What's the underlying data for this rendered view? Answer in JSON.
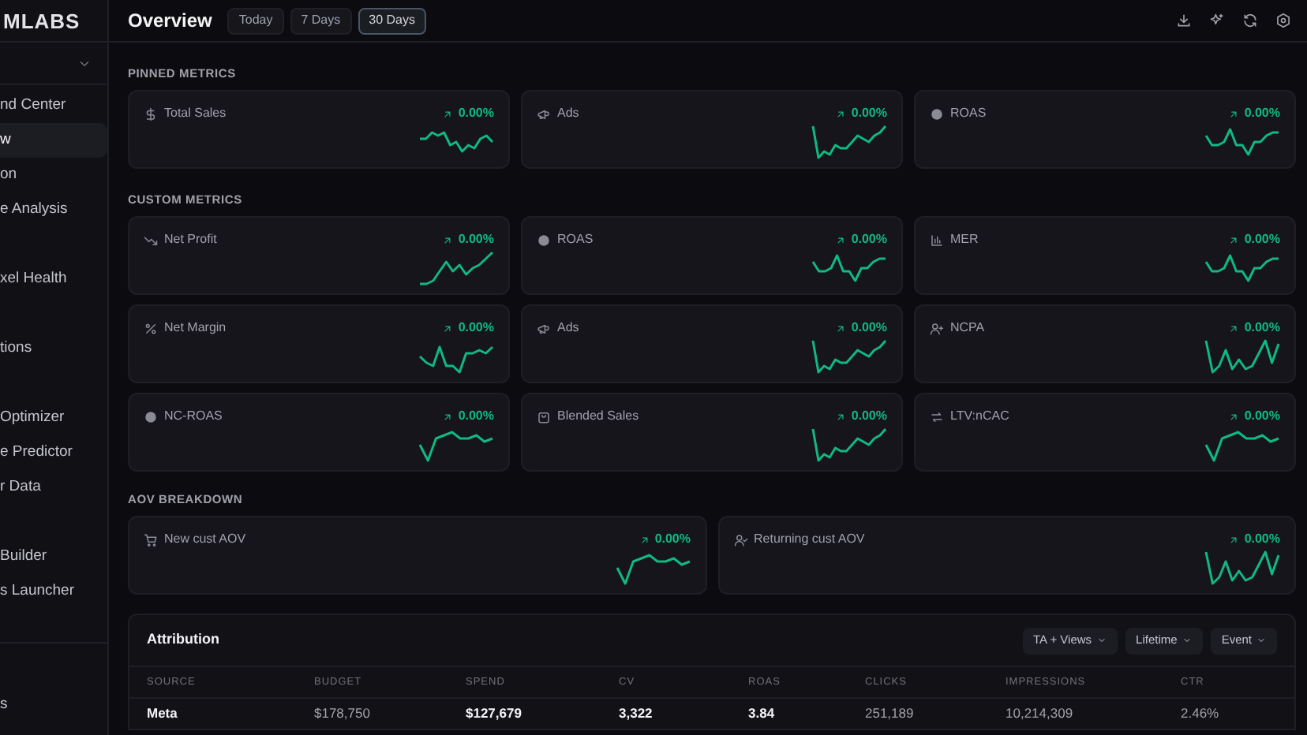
{
  "sidebar": {
    "logo": "MLABS",
    "groups": [
      {
        "items": [
          {
            "label": "nd Center",
            "selected": false
          },
          {
            "label": "w",
            "selected": true
          },
          {
            "label": "on",
            "selected": false
          },
          {
            "label": "e Analysis",
            "selected": false
          }
        ]
      },
      {
        "items": [
          {
            "label": "xel Health",
            "selected": false
          }
        ]
      },
      {
        "items": [
          {
            "label": "tions",
            "selected": false
          }
        ]
      },
      {
        "items": [
          {
            "label": "Optimizer",
            "selected": false
          },
          {
            "label": "e Predictor",
            "selected": false
          },
          {
            "label": "r Data",
            "selected": false
          }
        ]
      },
      {
        "items": [
          {
            "label": "Builder",
            "selected": false
          },
          {
            "label": "s Launcher",
            "selected": false
          }
        ]
      }
    ],
    "footer": "s"
  },
  "header": {
    "title": "Overview",
    "ranges": [
      {
        "label": "Today",
        "selected": false
      },
      {
        "label": "7 Days",
        "selected": false
      },
      {
        "label": "30 Days",
        "selected": true
      }
    ]
  },
  "sections": [
    {
      "title": "PINNED METRICS",
      "cards": [
        {
          "label": "Total Sales",
          "change": "0.00%"
        },
        {
          "label": "Ads",
          "change": "0.00%"
        },
        {
          "label": "ROAS",
          "change": "0.00%"
        }
      ]
    },
    {
      "title": "CUSTOM METRICS",
      "cards": [
        {
          "label": "Net Profit",
          "change": "0.00%"
        },
        {
          "label": "ROAS",
          "change": "0.00%"
        },
        {
          "label": "MER",
          "change": "0.00%"
        },
        {
          "label": "Net Margin",
          "change": "0.00%"
        },
        {
          "label": "Ads",
          "change": "0.00%"
        },
        {
          "label": "NCPA",
          "change": "0.00%"
        },
        {
          "label": "NC-ROAS",
          "change": "0.00%"
        },
        {
          "label": "Blended Sales",
          "change": "0.00%"
        },
        {
          "label": "LTV:nCAC",
          "change": "0.00%"
        }
      ]
    },
    {
      "title": "AOV BREAKDOWN",
      "cards": [
        {
          "label": "New cust AOV",
          "change": "0.00%"
        },
        {
          "label": "Returning cust AOV",
          "change": "0.00%"
        }
      ]
    }
  ],
  "attribution": {
    "title": "Attribution",
    "filters": [
      "TA + Views",
      "Lifetime",
      "Event"
    ],
    "columns": [
      "SOURCE",
      "BUDGET",
      "SPEND",
      "CV",
      "ROAS",
      "CLICKS",
      "IMPRESSIONS",
      "CTR"
    ],
    "rows": [
      [
        "Meta",
        "$178,750",
        "$127,679",
        "3,322",
        "3.84",
        "251,189",
        "10,214,309",
        "2.46%"
      ]
    ]
  }
}
